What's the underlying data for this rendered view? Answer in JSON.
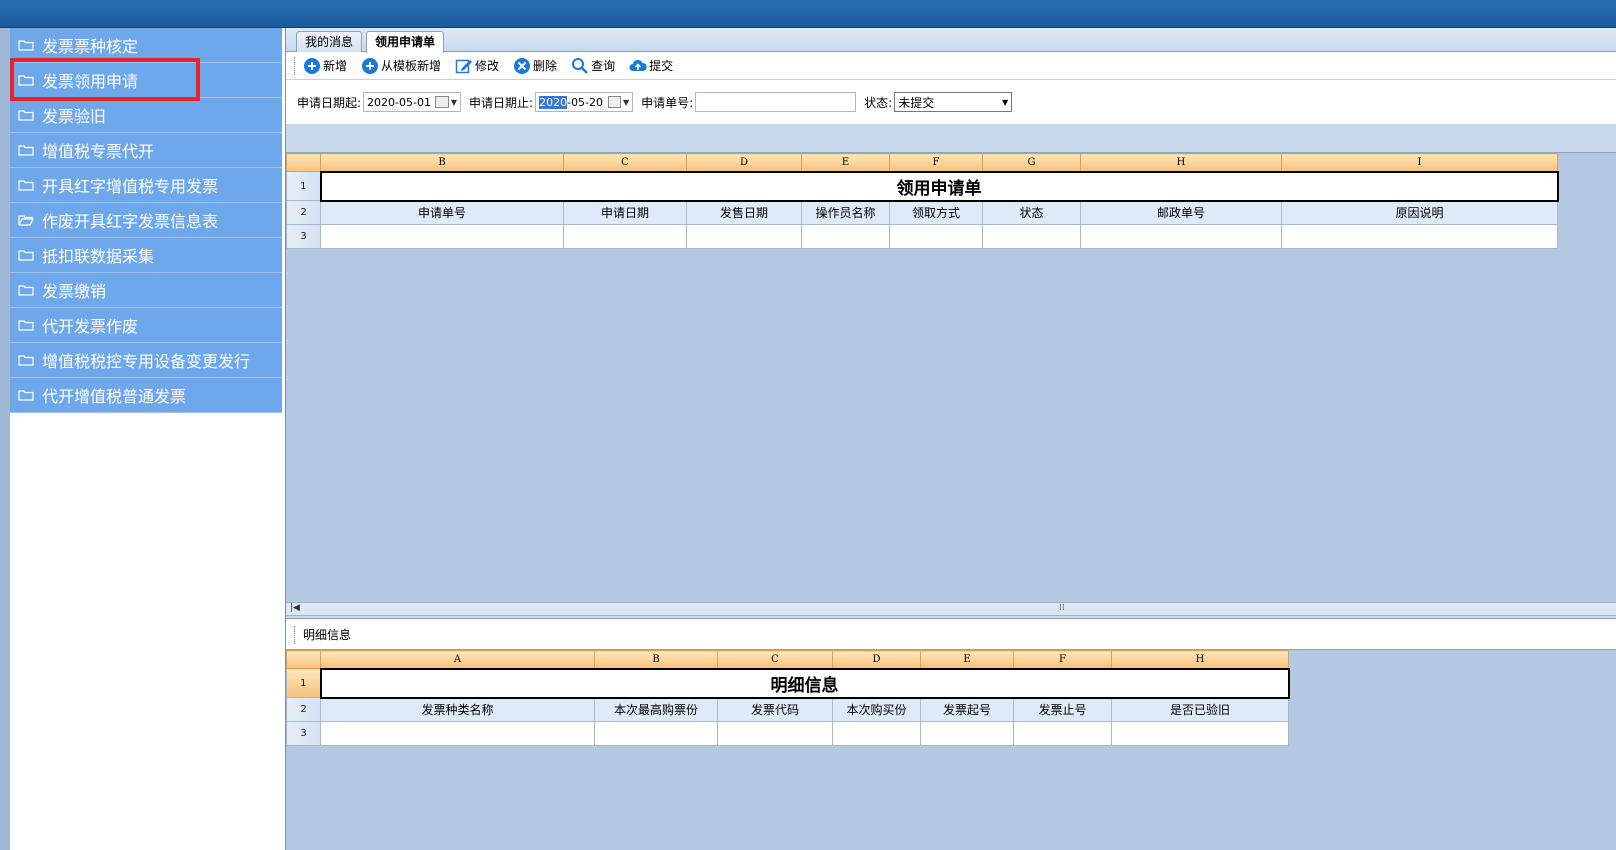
{
  "sidebar": {
    "items": [
      {
        "label": "发票票种核定",
        "icon": "folder-icon"
      },
      {
        "label": "发票领用申请",
        "icon": "folder-icon"
      },
      {
        "label": "发票验旧",
        "icon": "folder-icon"
      },
      {
        "label": "增值税专票代开",
        "icon": "folder-icon"
      },
      {
        "label": "开具红字增值税专用发票",
        "icon": "folder-icon"
      },
      {
        "label": "作废开具红字发票信息表",
        "icon": "folder-open-icon"
      },
      {
        "label": "抵扣联数据采集",
        "icon": "folder-icon"
      },
      {
        "label": "发票缴销",
        "icon": "folder-icon"
      },
      {
        "label": "代开发票作废",
        "icon": "folder-icon"
      },
      {
        "label": "增值税税控专用设备变更发行",
        "icon": "folder-icon"
      },
      {
        "label": "代开增值税普通发票",
        "icon": "folder-icon"
      }
    ]
  },
  "tabs": [
    {
      "label": "我的消息"
    },
    {
      "label": "领用申请单"
    }
  ],
  "toolbar": {
    "add": "新增",
    "add_from_template": "从模板新增",
    "edit": "修改",
    "delete": "删除",
    "query": "查询",
    "submit": "提交"
  },
  "filters": {
    "start_label": "申请日期起:",
    "start_value": "2020-05-01",
    "end_label": "申请日期止:",
    "end_value_selected": "2020",
    "end_value_rest": "-05-20",
    "number_label": "申请单号:",
    "number_value": "",
    "status_label": "状态:",
    "status_value": "未提交"
  },
  "grid1": {
    "columns": [
      "B",
      "C",
      "D",
      "E",
      "F",
      "G",
      "H",
      "I"
    ],
    "rows": [
      "1",
      "2",
      "3"
    ],
    "title": "领用申请单",
    "headers": [
      "申请单号",
      "申请日期",
      "发售日期",
      "操作员名称",
      "领取方式",
      "状态",
      "邮政单号",
      "原因说明"
    ]
  },
  "detail": {
    "label": "明细信息"
  },
  "grid2": {
    "columns": [
      "A",
      "B",
      "C",
      "D",
      "E",
      "F",
      "H"
    ],
    "rows": [
      "1",
      "2",
      "3"
    ],
    "title": "明细信息",
    "headers": [
      "发票种类名称",
      "本次最高购票份",
      "发票代码",
      "本次购买份",
      "发票起号",
      "发票止号",
      "是否已验旧"
    ]
  },
  "colors": {
    "sidebar_item": "#6fa8ea",
    "highlight": "#e8242a",
    "grid_bg": "#b4c8e2",
    "col_header": "#f5c27a"
  }
}
